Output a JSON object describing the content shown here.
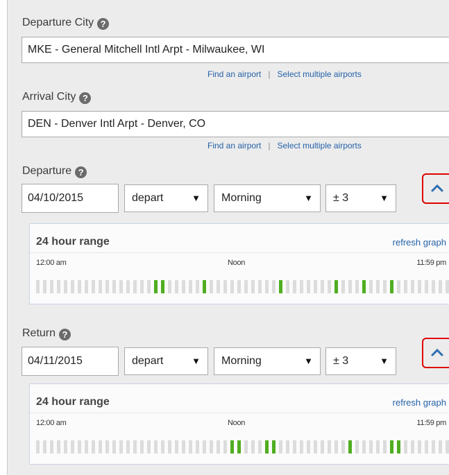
{
  "departure_city": {
    "label": "Departure City",
    "value": "MKE - General Mitchell Intl Arpt - Milwaukee, WI",
    "find_link": "Find an airport",
    "separator": "|",
    "multi_link": "Select multiple airports"
  },
  "arrival_city": {
    "label": "Arrival City",
    "value": "DEN - Denver Intl Arpt - Denver, CO",
    "find_link": "Find an airport",
    "separator": "|",
    "multi_link": "Select multiple airports"
  },
  "help_glyph": "?",
  "departure": {
    "label": "Departure",
    "date": "04/10/2015",
    "mode": "depart",
    "time": "Morning",
    "flex": "± 3",
    "range": {
      "title": "24 hour range",
      "refresh": "refresh graph",
      "tick_start": "12:00 am",
      "tick_mid": "Noon",
      "tick_end": "11:59 pm",
      "active_slots": [
        17,
        18,
        24,
        35,
        43,
        47,
        51
      ]
    }
  },
  "return": {
    "label": "Return",
    "date": "04/11/2015",
    "mode": "depart",
    "time": "Morning",
    "flex": "± 3",
    "range": {
      "title": "24 hour range",
      "refresh": "refresh graph",
      "tick_start": "12:00 am",
      "tick_mid": "Noon",
      "tick_end": "11:59 pm",
      "active_slots": [
        28,
        29,
        33,
        34,
        45,
        51,
        52
      ]
    }
  },
  "icons": {
    "help": "help-circle-icon",
    "dropdown": "triangle-down-icon",
    "collapse": "chevron-up-icon"
  },
  "colors": {
    "collapse_border": "#e00000",
    "bar_active": "#4fae20",
    "bar_inactive": "#dcdcdc",
    "link": "#2561a8"
  },
  "slot_count": 60
}
